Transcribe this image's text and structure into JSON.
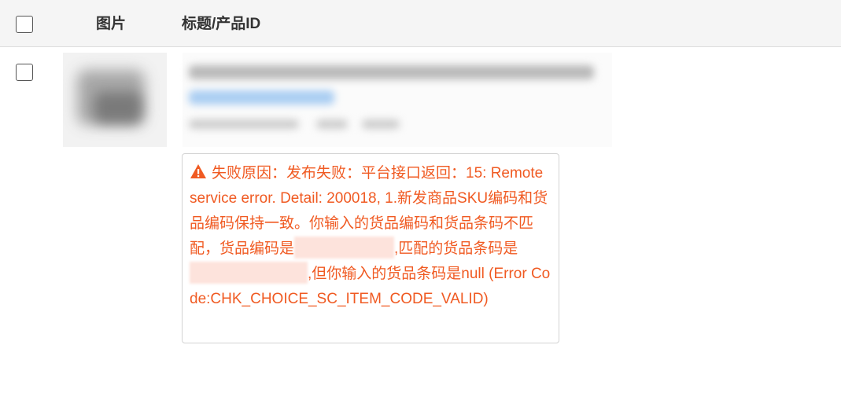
{
  "header": {
    "col_image": "图片",
    "col_title": "标题/产品ID"
  },
  "row": {
    "error": {
      "part1": "失败原因：发布失败：平台接口返回：15: Remote service error. Detail: 200018, 1.新发商品SKU编码和货品编码保持一致。你输入的货品编码和货品条码不匹配，货品编码是",
      "part2": ",匹配的货品条码是",
      "part3": ",但你输入的货品条码是null (Error Code:CHK_CHOICE_SC_ITEM_CODE_VALID)"
    }
  },
  "colors": {
    "error_text": "#f05a22",
    "header_bg": "#f5f5f5",
    "border": "#d3d3d3"
  },
  "icons": [
    "warning-icon"
  ]
}
